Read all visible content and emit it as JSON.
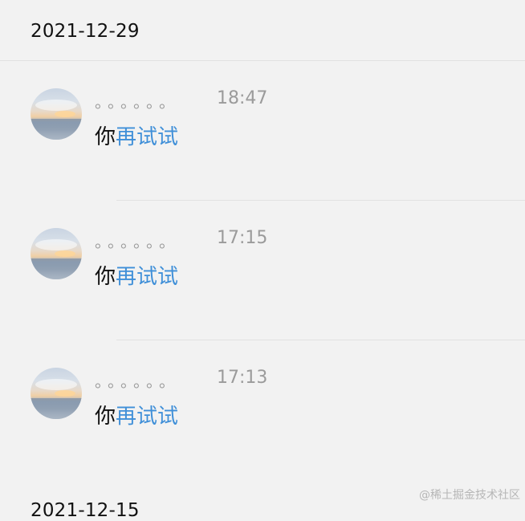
{
  "groups": [
    {
      "date": "2021-12-29",
      "messages": [
        {
          "nickname": "。。。。。。",
          "time": "18:47",
          "text_plain": "你",
          "text_link": "再试试"
        },
        {
          "nickname": "。。。。。。",
          "time": "17:15",
          "text_plain": "你",
          "text_link": "再试试"
        },
        {
          "nickname": "。。。。。。",
          "time": "17:13",
          "text_plain": "你",
          "text_link": "再试试"
        }
      ]
    },
    {
      "date": "2021-12-15"
    }
  ],
  "watermark": "@稀土掘金技术社区",
  "colors": {
    "background": "#f2f2f2",
    "link": "#3f8fd8",
    "muted": "#9b9b9b",
    "divider": "#e2e2e2"
  },
  "icons": [
    "avatar"
  ]
}
